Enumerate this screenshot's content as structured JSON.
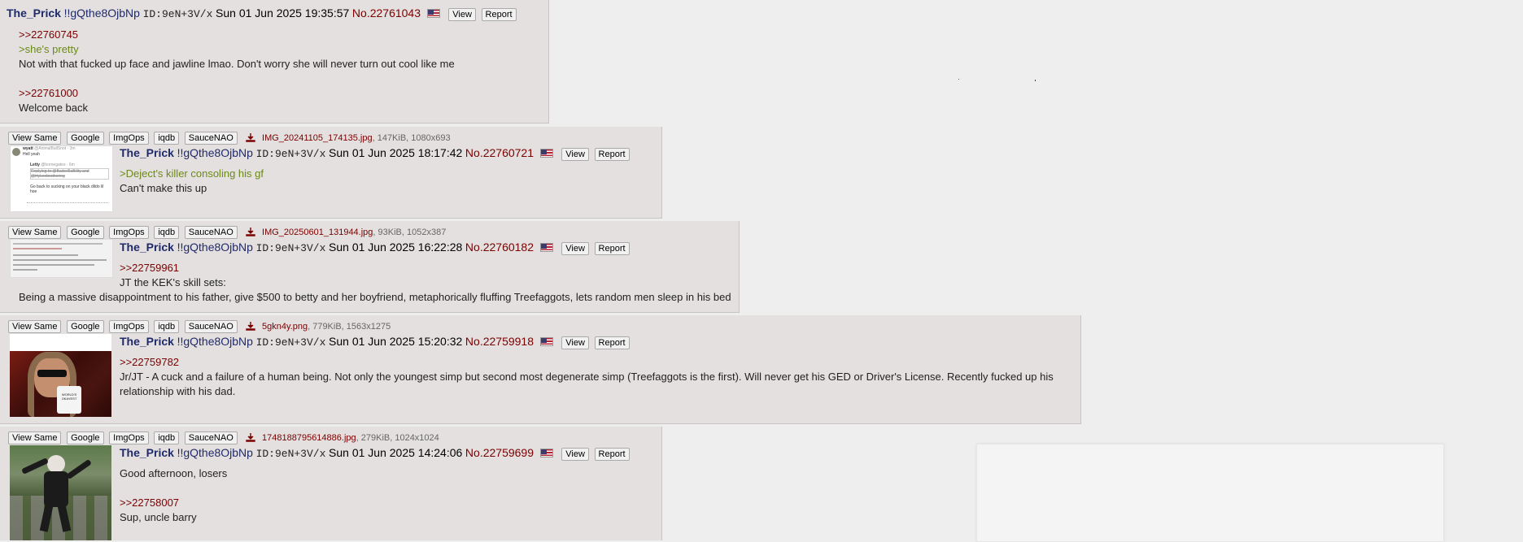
{
  "common": {
    "name": "The_Prick",
    "trip": "!!gQthe8OjbNp",
    "id_label": "ID:9eN+3V/x",
    "view_label": "View",
    "report_label": "Report"
  },
  "toolbar_labels": [
    "View Same",
    "Google",
    "ImgOps",
    "iqdb",
    "SauceNAO"
  ],
  "posts": [
    {
      "date": "Sun 01 Jun 2025 19:35:57",
      "no": "No.22761043",
      "lines": [
        ">>22760745",
        ">she's pretty",
        "Not with that fucked up face and jawline lmao. Don't worry she will never turn out cool like me",
        ">>22761000",
        "Welcome back"
      ]
    },
    {
      "file": {
        "name": "IMG_20241105_174135.jpg",
        "meta": ", 147KiB, 1080x693"
      },
      "date": "Sun 01 Jun 2025 18:17:42",
      "no": "No.22760721",
      "lines": [
        ">Deject's killer consoling his gf",
        "Can't make this up"
      ]
    },
    {
      "file": {
        "name": "IMG_20250601_131944.jpg",
        "meta": ", 93KiB, 1052x387"
      },
      "date": "Sun 01 Jun 2025 16:22:28",
      "no": "No.22760182",
      "lines": [
        ">>22759961",
        "JT the KEK's skill sets:",
        "Being a massive disappointment to his father, give $500 to betty and her boyfriend, metaphorically fluffing Treefaggots, lets random men sleep in his bed"
      ]
    },
    {
      "file": {
        "name": "5gkn4y.png",
        "meta": ", 779KiB, 1563x1275"
      },
      "date": "Sun 01 Jun 2025 15:20:32",
      "no": "No.22759918",
      "lines": [
        ">>22759782",
        "Jr/JT - A cuck and a failure of a human being. Not only the youngest simp but second most degenerate simp (Treefaggots is the first). Will never get his GED or Driver's License. Recently fucked up his",
        "relationship with his dad."
      ]
    },
    {
      "file": {
        "name": "1748188795614886.jpg",
        "meta": ", 279KiB, 1024x1024"
      },
      "date": "Sun 01 Jun 2025 14:24:06",
      "no": "No.22759699",
      "lines": [
        "Good afternoon, losers",
        ">>22758007",
        "Sup, uncle barry"
      ]
    }
  ],
  "thumb_text": {
    "tweet_user": "wyatt",
    "tweet_handle": "@AnimalBallSnot · 3m",
    "tweet_text1": "Hell yeah",
    "tweet_reply_user": "Letty",
    "tweet_reply_handle": "@bornegates · 6m",
    "tweet_reply_strike": "Replying to @BarbellIaBility and @Hykenbrothering",
    "tweet_reply_text": "Go back to sucking on your black dildo lil hoe",
    "mug_text": "WORLD'S OKAYEST"
  }
}
